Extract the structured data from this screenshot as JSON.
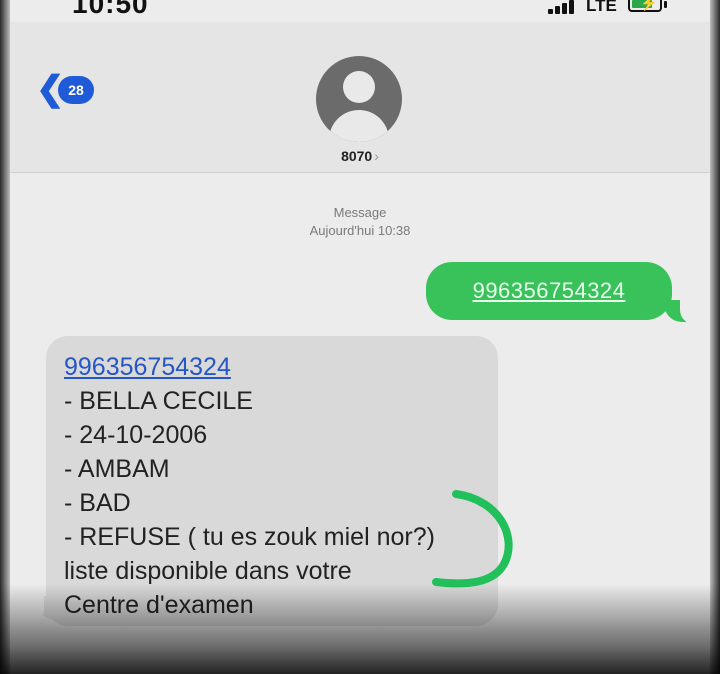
{
  "status": {
    "time": "10:50",
    "network": "LTE"
  },
  "header": {
    "unread_count": "28",
    "contact_name": "8070"
  },
  "thread": {
    "meta_line1": "Message",
    "meta_line2": "Aujourd'hui 10:38"
  },
  "outgoing": {
    "text": "996356754324"
  },
  "incoming": {
    "link": "996356754324",
    "lines": [
      "- BELLA CECILE",
      "- 24-10-2006",
      "- AMBAM",
      "- BAD",
      "- REFUSE ( tu es zouk miel nor?)",
      "liste disponible dans votre",
      "Centre d'examen"
    ]
  },
  "colors": {
    "outgoing_bubble": "#39c25a",
    "incoming_bubble": "#d9d9d9",
    "accent": "#1f5bd6",
    "annotation": "#22c05a"
  },
  "icons": [
    "back-chevron-icon",
    "signal-icon",
    "battery-icon",
    "contact-avatar-icon"
  ]
}
